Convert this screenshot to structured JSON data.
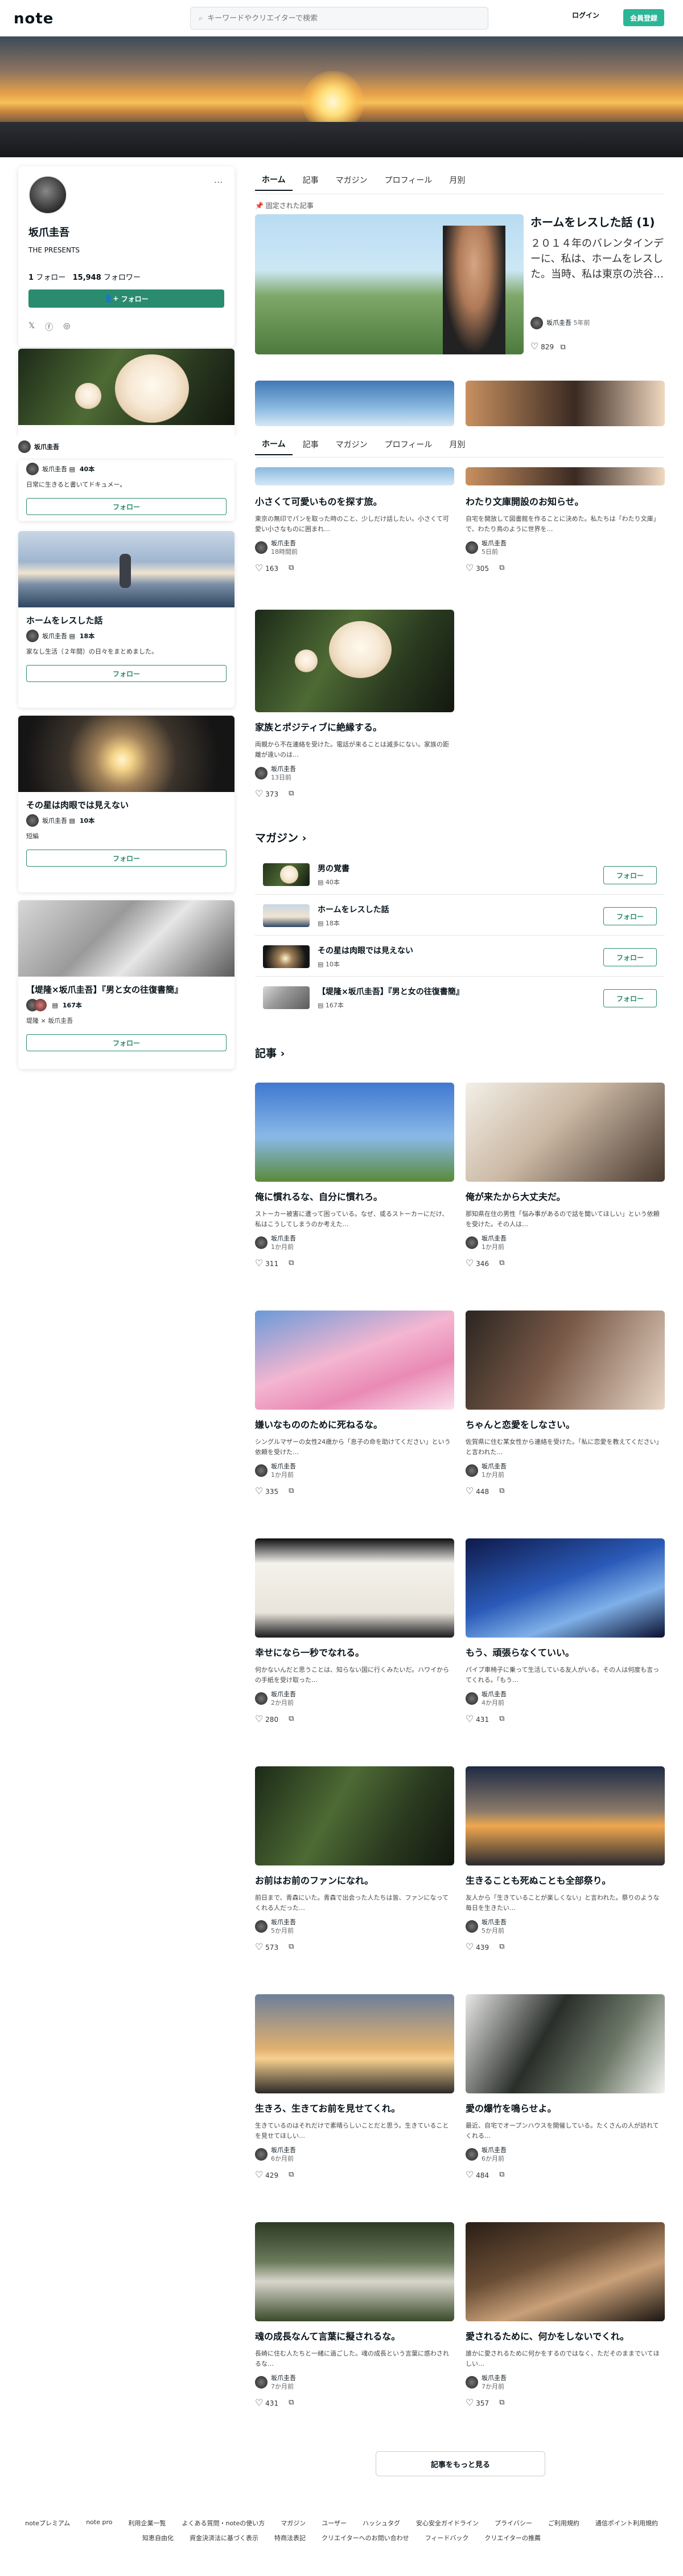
{
  "header": {
    "logo": "note",
    "search_placeholder": "キーワードやクリエイターで検索",
    "login": "ログイン",
    "signup": "会員登録"
  },
  "profile": {
    "name": "坂爪圭吾",
    "desc": "THE PRESENTS",
    "follow_count": "1",
    "follow_label": "フォロー",
    "follower_count": "15,948",
    "follower_label": "フォロワー",
    "follow_button": "フォロー",
    "menu_icon": "..."
  },
  "tabs": [
    "ホーム",
    "記事",
    "マガジン",
    "プロフィール",
    "月別"
  ],
  "pinned": {
    "label": "固定された記事",
    "title": "ホームをレスした話 (1)",
    "excerpt": "２０１４年のバレンタインデーに、私は、ホームをレスした。当時、私は東京の渋谷…",
    "author": "坂爪圭吾",
    "date": "5年前",
    "likes": "829"
  },
  "sticky_author": "坂爪圭吾",
  "left_magazines": [
    {
      "title": "",
      "author": "坂爪圭吾",
      "count": "40本",
      "desc": "日常に生きると書いてドキュメー。",
      "follow": "フォロー"
    },
    {
      "title": "ホームをレスした話",
      "author": "坂爪圭吾",
      "count": "18本",
      "desc": "家なし生活（２年間）の日々をまとめました。",
      "follow": "フォロー"
    },
    {
      "title": "その星は肉眼では見えない",
      "author": "坂爪圭吾",
      "count": "10本",
      "desc": "短編",
      "follow": "フォロー"
    },
    {
      "title": "【堤隆×坂爪圭吾】『男と女の往復書簡』",
      "author": "堤隆 × 坂爪圭吾",
      "count": "167本",
      "desc": "",
      "follow": "フォロー"
    }
  ],
  "top_cards": [
    {
      "title": "小さくて可愛いものを探す旅。",
      "excerpt": "東京の無印でパンを取った時のこと、少しだけ話したい。小さくて可愛い小さなものに囲まれ…",
      "author": "坂爪圭吾",
      "date": "18時間前",
      "likes": "163"
    },
    {
      "title": "わたり文庫開設のお知らせ。",
      "excerpt": "自宅を開放して図書館を作ることに決めた。私たちは「わたり文庫」で、わたり鳥のように世界を…",
      "author": "坂爪圭吾",
      "date": "5日前",
      "likes": "305"
    },
    {
      "title": "家族とポジティブに絶縁する。",
      "excerpt": "両親から不在連絡を受けた。電話が来ることは滅多にない。家族の距離が遠いのは…",
      "author": "坂爪圭吾",
      "date": "13日前",
      "likes": "373"
    }
  ],
  "magazine_section": {
    "title": "マガジン",
    "rows": [
      {
        "title": "男の覚書",
        "count": "40本",
        "follow": "フォロー"
      },
      {
        "title": "ホームをレスした話",
        "count": "18本",
        "follow": "フォロー"
      },
      {
        "title": "その星は肉眼では見えない",
        "count": "10本",
        "follow": "フォロー"
      },
      {
        "title": "【堤隆×坂爪圭吾】『男と女の往復書簡』",
        "count": "167本",
        "follow": "フォロー"
      }
    ]
  },
  "articles_section": {
    "title": "記事",
    "cards": [
      {
        "title": "俺に慣れるな、自分に慣れろ。",
        "excerpt": "ストーカー被害に遭って困っている。なぜ、或るストーカーにだけ、私はこうしてしまうのか考えた…",
        "author": "坂爪圭吾",
        "date": "1か月前",
        "likes": "311"
      },
      {
        "title": "俺が来たから大丈夫だ。",
        "excerpt": "那知県在住の男性「悩み事があるので話を聞いてほしい」という依頼を受けた。その人は…",
        "author": "坂爪圭吾",
        "date": "1か月前",
        "likes": "346"
      },
      {
        "title": "嫌いなもののために死ねるな。",
        "excerpt": "シングルマザーの女性24歳から「息子の命を助けてください」という依頼を受けた…",
        "author": "坂爪圭吾",
        "date": "1か月前",
        "likes": "335"
      },
      {
        "title": "ちゃんと恋愛をしなさい。",
        "excerpt": "佐賀県に住む某女性から連絡を受けた。「私に恋愛を教えてください」と言われた…",
        "author": "坂爪圭吾",
        "date": "1か月前",
        "likes": "448"
      },
      {
        "title": "幸せになら一秒でなれる。",
        "excerpt": "何かないんだと思うことは、知らない国に行くみたいだ。ハワイからの手紙を受け取った…",
        "author": "坂爪圭吾",
        "date": "2か月前",
        "likes": "280"
      },
      {
        "title": "もう、頑張らなくていい。",
        "excerpt": "パイプ車椅子に乗って生活している友人がいる。その人は何度も言ってくれる。「もう…",
        "author": "坂爪圭吾",
        "date": "4か月前",
        "likes": "431"
      },
      {
        "title": "お前はお前のファンになれ。",
        "excerpt": "前日まで、青森にいた。青森で出会った人たちは皆、ファンになってくれる人だった…",
        "author": "坂爪圭吾",
        "date": "5か月前",
        "likes": "573"
      },
      {
        "title": "生きることも死ぬことも全部祭り。",
        "excerpt": "友人から「生きていることが楽しくない」と言われた。祭りのような毎日を生きたい…",
        "author": "坂爪圭吾",
        "date": "5か月前",
        "likes": "439"
      },
      {
        "title": "生きろ、生きてお前を見せてくれ。",
        "excerpt": "生きているのはそれだけで素晴らしいことだと思う。生きていることを見せてほしい…",
        "author": "坂爪圭吾",
        "date": "6か月前",
        "likes": "429"
      },
      {
        "title": "愛の爆竹を鳴らせよ。",
        "excerpt": "最近、自宅でオープンハウスを開催している。たくさんの人が訪れてくれる…",
        "author": "坂爪圭吾",
        "date": "6か月前",
        "likes": "484"
      },
      {
        "title": "魂の成長なんて言葉に擬されるな。",
        "excerpt": "長崎に住む人たちと一緒に過ごした。魂の成長という言葉に惑わされるな…",
        "author": "坂爪圭吾",
        "date": "7か月前",
        "likes": "431"
      },
      {
        "title": "愛されるために、何かをしないでくれ。",
        "excerpt": "誰かに愛されるために何かをするのではなく、ただそのままでいてほしい…",
        "author": "坂爪圭吾",
        "date": "7か月前",
        "likes": "357"
      }
    ]
  },
  "more_button": "記事をもっと見る",
  "footer": {
    "row1": [
      "noteプレミアム",
      "note pro",
      "利用企業一覧",
      "よくある質問・noteの使い方",
      "マガジン",
      "ユーザー",
      "ハッシュタグ",
      "安心安全ガイドライン",
      "プライバシー",
      "ご利用規約",
      "通信ポイント利用規約"
    ],
    "row2": [
      "知恵自由化",
      "資金決済法に基づく表示",
      "特商法表記",
      "クリエイターへのお問い合わせ",
      "フィードバック",
      "クリエイターの推薦"
    ]
  },
  "colors": {
    "accent": "#2cb696",
    "follow": "#2a8c6e"
  }
}
